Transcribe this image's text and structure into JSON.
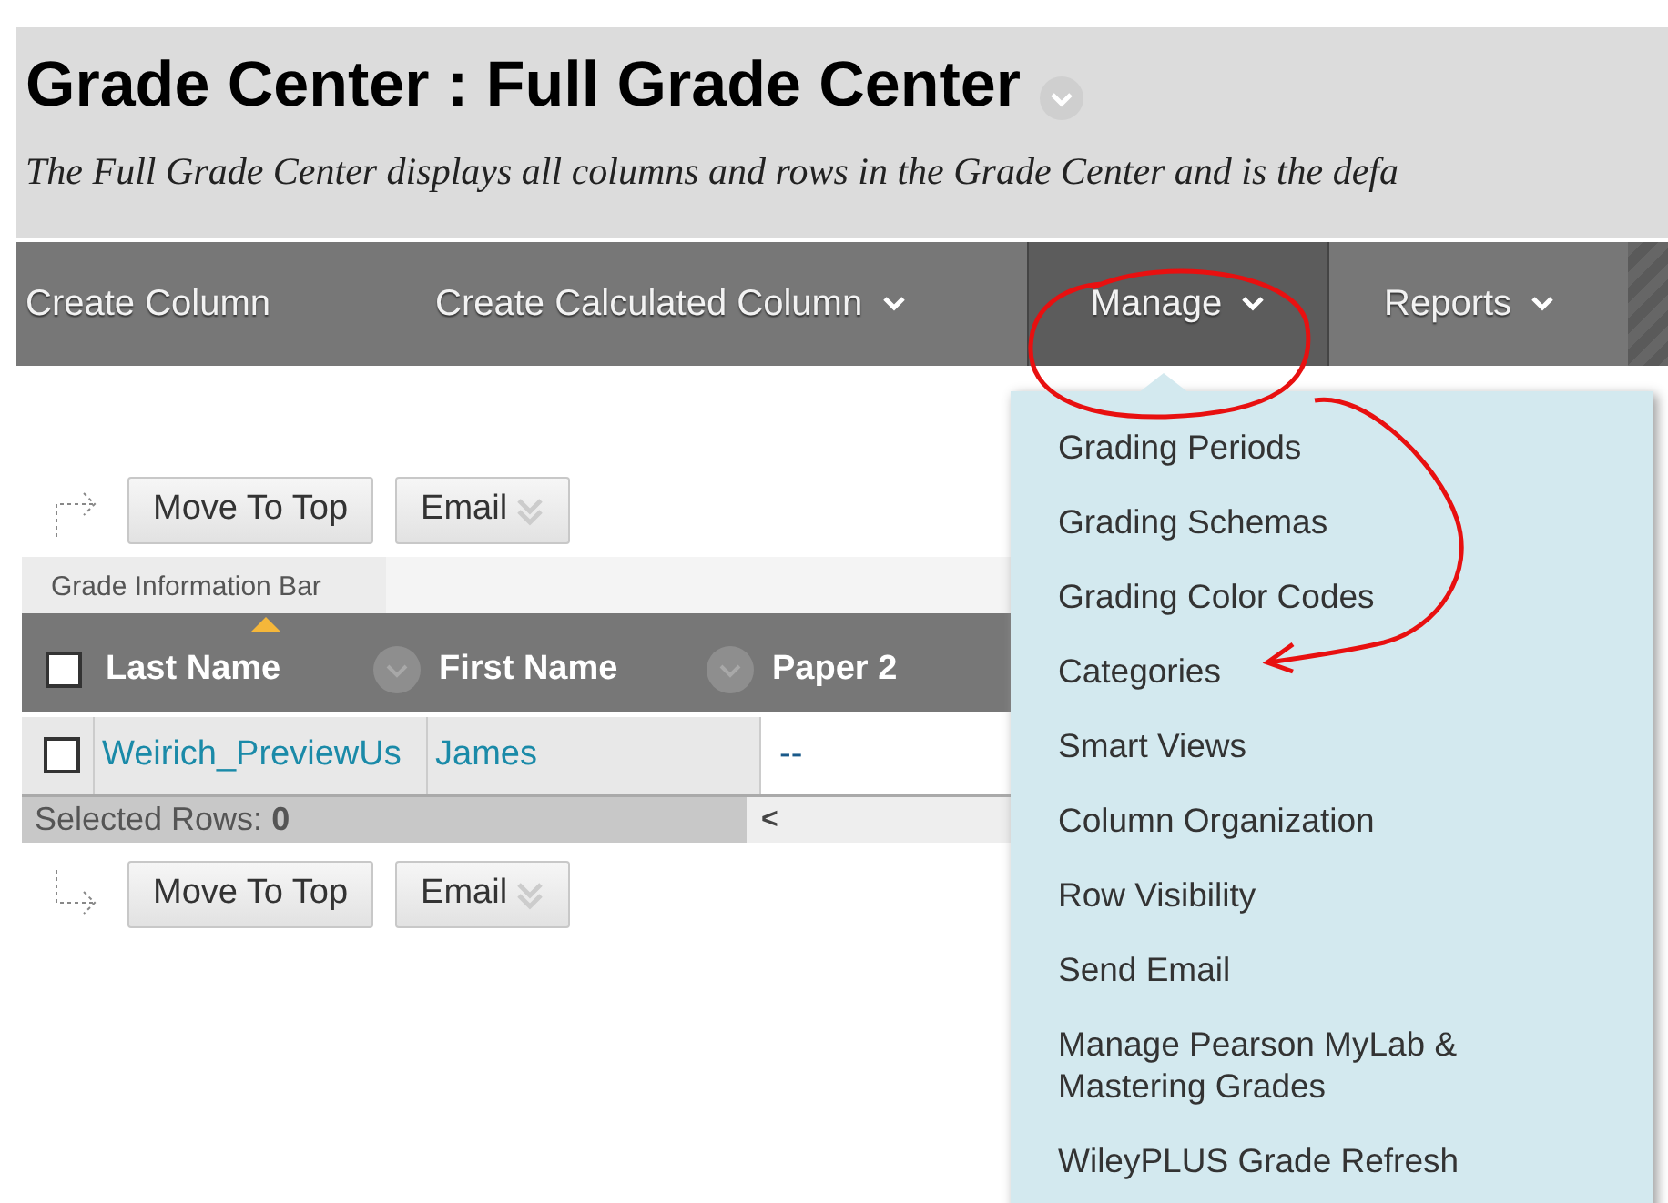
{
  "header": {
    "title": "Grade Center : Full Grade Center",
    "subtitle": "The Full Grade Center displays all columns and rows in the Grade Center and is the defa"
  },
  "nav": [
    {
      "label": "Create Column",
      "has_caret": false,
      "selected": false
    },
    {
      "label": "Create Calculated Column",
      "has_caret": true,
      "selected": false
    },
    {
      "label": "Manage",
      "has_caret": true,
      "selected": true
    },
    {
      "label": "Reports",
      "has_caret": true,
      "selected": false
    }
  ],
  "dropdown": [
    "Grading Periods",
    "Grading Schemas",
    "Grading Color Codes",
    "Categories",
    "Smart Views",
    "Column Organization",
    "Row Visibility",
    "Send Email",
    "Manage Pearson MyLab & Mastering Grades",
    "WileyPLUS Grade Refresh"
  ],
  "toolbar_top": [
    {
      "label": "Move To Top",
      "kind": "plain"
    },
    {
      "label": "Email",
      "kind": "menu"
    }
  ],
  "info_bar": {
    "label": "Grade Information Bar"
  },
  "table": {
    "select_all": {
      "checked": false
    },
    "columns": [
      {
        "label": "Last Name",
        "sorted": true
      },
      {
        "label": "First Name",
        "sorted": false
      },
      {
        "label": "Paper 2",
        "sorted": false
      }
    ],
    "rows": [
      {
        "checked": false,
        "cells": [
          "Weirich_PreviewUs",
          "James",
          "--"
        ]
      }
    ],
    "footer": "Selected Rows: **0**",
    "scroll": "<"
  },
  "toolbar_bottom": [
    {
      "label": "Move To Top",
      "kind": "plain"
    },
    {
      "label": "Email",
      "kind": "menu"
    }
  ]
}
